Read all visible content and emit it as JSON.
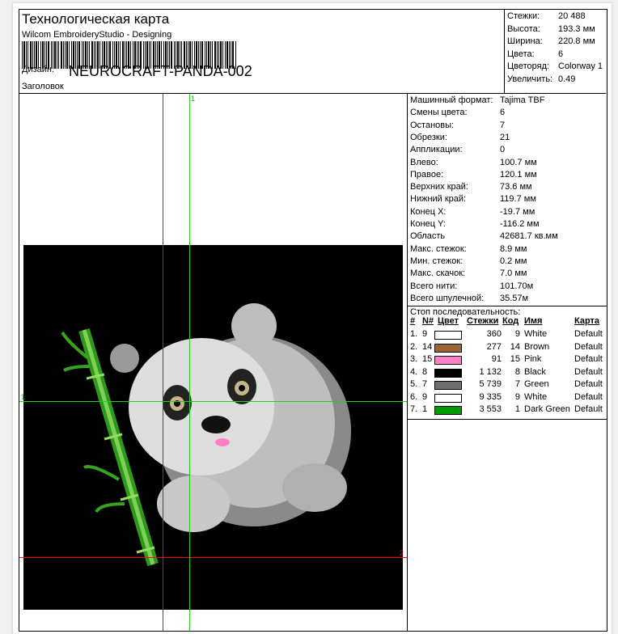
{
  "header": {
    "title": "Технологическая карта",
    "subtitle": "Wilcom EmbroideryStudio - Designing",
    "design_label": "Дизайн:",
    "design_value": "NEUROCRAFT-PANDA-002",
    "heading_label": "Заголовок"
  },
  "summary": [
    {
      "label": "Стежки:",
      "value": "20 488"
    },
    {
      "label": "Высота:",
      "value": "193.3 мм"
    },
    {
      "label": "Ширина:",
      "value": "220.8 мм"
    },
    {
      "label": "Цвета:",
      "value": "6"
    },
    {
      "label": "Цветоряд:",
      "value": "Colorway 1"
    },
    {
      "label": "Увеличить:",
      "value": "0.49"
    }
  ],
  "details": [
    {
      "label": "Машинный формат:",
      "value": "Tajima TBF"
    },
    {
      "label": "Смены цвета:",
      "value": "6"
    },
    {
      "label": "Остановы:",
      "value": "7"
    },
    {
      "label": "Обрезки:",
      "value": "21"
    },
    {
      "label": "Аппликации:",
      "value": "0"
    },
    {
      "label": "Влево:",
      "value": "100.7 мм"
    },
    {
      "label": "Правое:",
      "value": "120.1 мм"
    },
    {
      "label": "Верхних край:",
      "value": "73.6 мм"
    },
    {
      "label": "Нижний край:",
      "value": "119.7 мм"
    },
    {
      "label": "Конец X:",
      "value": "-19.7 мм"
    },
    {
      "label": "Конец Y:",
      "value": "-116.2 мм"
    },
    {
      "label": "Область",
      "value": "42681.7 кв.мм"
    },
    {
      "label": "Макс. стежок:",
      "value": "8.9 мм"
    },
    {
      "label": "Мин. стежок:",
      "value": "0.2 мм"
    },
    {
      "label": "Макс. скачок:",
      "value": "7.0 мм"
    },
    {
      "label": "Всего нити:",
      "value": "101.70м"
    },
    {
      "label": "Всего шпулечной:",
      "value": "35.57м"
    }
  ],
  "stop_sequence": {
    "title": "Стоп последовательность:",
    "columns": [
      "#",
      "N#",
      "Цвет",
      "Стежки",
      "Код",
      "Имя",
      "Карта"
    ],
    "rows": [
      {
        "idx": "1.",
        "n": "9",
        "color": "#ffffff",
        "stitches": "360",
        "code": "9",
        "name": "White",
        "chart": "Default"
      },
      {
        "idx": "2.",
        "n": "14",
        "color": "#996633",
        "stitches": "277",
        "code": "14",
        "name": "Brown",
        "chart": "Default"
      },
      {
        "idx": "3.",
        "n": "15",
        "color": "#ff80c8",
        "stitches": "91",
        "code": "15",
        "name": "Pink",
        "chart": "Default"
      },
      {
        "idx": "4.",
        "n": "8",
        "color": "#000000",
        "stitches": "1 132",
        "code": "8",
        "name": "Black",
        "chart": "Default"
      },
      {
        "idx": "5.",
        "n": "7",
        "color": "#707070",
        "stitches": "5 739",
        "code": "7",
        "name": "Green",
        "chart": "Default"
      },
      {
        "idx": "6.",
        "n": "9",
        "color": "#ffffff",
        "stitches": "9 335",
        "code": "9",
        "name": "White",
        "chart": "Default"
      },
      {
        "idx": "7.",
        "n": "1",
        "color": "#009900",
        "stitches": "3 553",
        "code": "1",
        "name": "Dark Green",
        "chart": "Default"
      }
    ]
  },
  "markers": {
    "green": "1",
    "red": "2"
  }
}
